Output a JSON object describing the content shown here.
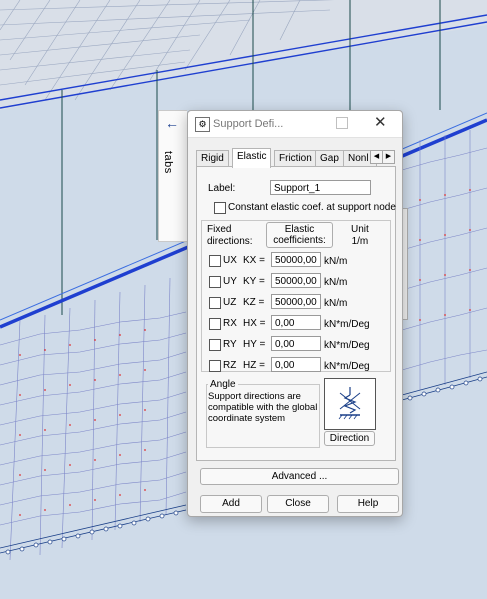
{
  "window": {
    "title": "Support Defi...",
    "minimize_label": "—",
    "maximize_label": "",
    "close_label": "✕"
  },
  "side_tab": {
    "label": "tabs",
    "arrow": "←"
  },
  "tabs": [
    {
      "label": "Rigid",
      "active": false
    },
    {
      "label": "Elastic",
      "active": true
    },
    {
      "label": "Friction",
      "active": false
    },
    {
      "label": "Gap",
      "active": false
    },
    {
      "label": "Nonl",
      "active": false
    }
  ],
  "tab_nav": {
    "prev": "◀",
    "next": "▶"
  },
  "form": {
    "label_caption": "Label:",
    "label_value": "Support_1",
    "constant_coef_caption": "Constant elastic coef. at support node",
    "constant_coef_checked": false,
    "fixed_directions_header": "Fixed\ndirections:",
    "elastic_coef_button": "Elastic\ncoefficients:",
    "unit_header": "Unit\n1/m",
    "rows": [
      {
        "dir": "UX",
        "coef": "KX =",
        "value": "50000,00",
        "unit": "kN/m",
        "checked": false
      },
      {
        "dir": "UY",
        "coef": "KY =",
        "value": "50000,00",
        "unit": "kN/m",
        "checked": false
      },
      {
        "dir": "UZ",
        "coef": "KZ =",
        "value": "50000,00",
        "unit": "kN/m",
        "checked": false
      },
      {
        "dir": "RX",
        "coef": "HX =",
        "value": "0,00",
        "unit": "kN*m/Deg",
        "checked": false
      },
      {
        "dir": "RY",
        "coef": "HY =",
        "value": "0,00",
        "unit": "kN*m/Deg",
        "checked": false
      },
      {
        "dir": "RZ",
        "coef": "HZ =",
        "value": "0,00",
        "unit": "kN*m/Deg",
        "checked": false
      }
    ],
    "angle_group_label": "Angle",
    "angle_text": "Support directions are compatible with the global coordinate system",
    "direction_button": "Direction"
  },
  "buttons": {
    "advanced": "Advanced ...",
    "add": "Add",
    "close": "Close",
    "help": "Help"
  },
  "colors": {
    "background": "#cfdbe9",
    "mesh_line": "#2f2fb0",
    "beam_blue": "#1f3fd0",
    "node_red": "#e03030",
    "pillar": "#1a4a4a",
    "support_icon": "#1a3f88"
  }
}
